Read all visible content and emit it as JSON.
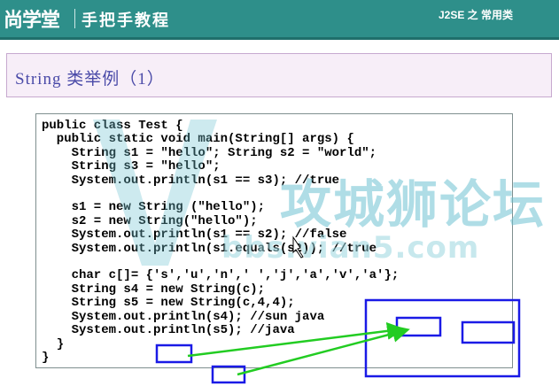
{
  "header": {
    "logo_text": "尚学堂",
    "tagline": "手把手教程",
    "course": "J2SE 之 常用类"
  },
  "slide": {
    "title": "String  类举例（1）"
  },
  "code": {
    "lines": [
      "public class Test {",
      "  public static void main(String[] args) {",
      "    String s1 = \"hello\"; String s2 = \"world\";",
      "    String s3 = \"hello\";",
      "    System.out.println(s1 == s3); //true",
      "",
      "    s1 = new String (\"hello\");",
      "    s2 = new String(\"hello\");",
      "    System.out.println(s1 == s2); //false",
      "    System.out.println(s1.equals(s2)); //true",
      "",
      "    char c[]= {'s','u','n',' ','j','a','v','a'};",
      "    String s4 = new String(c);",
      "    String s5 = new String(c,4,4);",
      "    System.out.println(s4); //sun java",
      "    System.out.println(s5); //java",
      "  }",
      "}"
    ]
  },
  "watermark": {
    "text": "攻城狮论坛",
    "url": "bbs.vian5.com"
  },
  "colors": {
    "header_bg": "#2e8f8a",
    "title_band_bg": "#f7eef8",
    "title_text": "#4a4aa8",
    "annotation_box": "#1a1ae6",
    "annotation_arrow": "#22cc22"
  }
}
